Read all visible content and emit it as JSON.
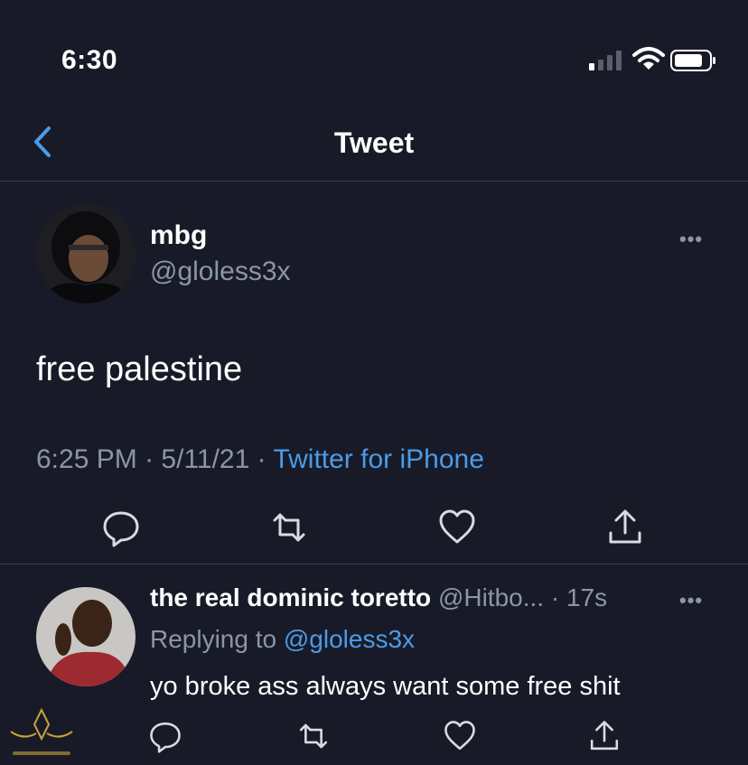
{
  "status_bar": {
    "time": "6:30"
  },
  "nav": {
    "title": "Tweet"
  },
  "tweet": {
    "name": "mbg",
    "handle": "@gloless3x",
    "text": "free palestine",
    "time": "6:25 PM",
    "date": "5/11/21",
    "separator": "·",
    "source": "Twitter for iPhone",
    "more": "•••"
  },
  "reply": {
    "name": "the real dominic toretto",
    "handle": "@Hitbo...",
    "age": "· 17s",
    "more": "•••",
    "replying_prefix": "Replying to",
    "replying_handle": "@gloless3x",
    "text": "yo broke ass always want some free shit"
  },
  "colors": {
    "background": "#181b27",
    "text": "#ffffff",
    "secondary": "#8b96a5",
    "accent": "#4b9be8"
  },
  "icons": [
    "chevron-left-icon",
    "signal-icon",
    "wifi-icon",
    "battery-icon",
    "more-icon",
    "reply-icon",
    "retweet-icon",
    "like-icon",
    "share-icon",
    "watermark-logo"
  ]
}
